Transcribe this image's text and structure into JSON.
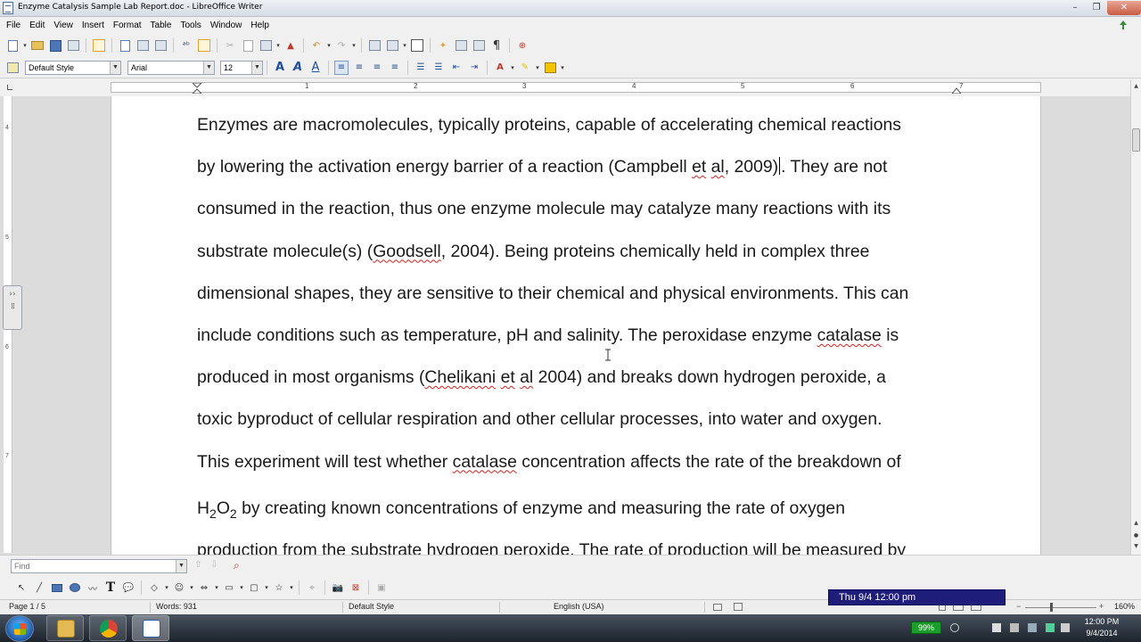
{
  "window": {
    "title": "Enzyme Catalysis Sample Lab Report.doc - LibreOffice Writer",
    "controls": [
      "–",
      "❐",
      "✕"
    ]
  },
  "menu": [
    "File",
    "Edit",
    "View",
    "Insert",
    "Format",
    "Table",
    "Tools",
    "Window",
    "Help"
  ],
  "format_bar": {
    "style": "Default Style",
    "font": "Arial",
    "size": "12"
  },
  "ruler_numbers": [
    "1",
    "2",
    "3",
    "4",
    "5",
    "6",
    "7"
  ],
  "document": {
    "lines": [
      [
        "Enzymes are macromolecules, typically proteins, capable of accelerating chemical reactions"
      ],
      [
        "by lowering the activation energy barrier of a reaction (Campbell ",
        "et",
        " ",
        "al",
        ", 2009)",
        ". They are not"
      ],
      [
        "consumed in the reaction, thus one enzyme molecule may catalyze many reactions with its"
      ],
      [
        "substrate molecule(s) (",
        "Goodsell",
        ", 2004). Being proteins chemically held in complex three"
      ],
      [
        "dimensional shapes, they are sensitive to their chemical and physical environments. This can"
      ],
      [
        "include conditions such as temperature, pH and salinity. The peroxidase enzyme ",
        "catalase",
        " is"
      ],
      [
        "produced in most organisms (",
        "Chelikani",
        " ",
        "et",
        " ",
        "al",
        " 2004) and breaks down hydrogen peroxide, a"
      ],
      [
        "toxic byproduct of cellular respiration and other cellular processes, into water and oxygen."
      ],
      [
        "This experiment will test whether ",
        "catalase",
        " concentration affects the rate of the breakdown of"
      ],
      [
        "H",
        "2",
        "O",
        "2",
        " by creating known concentrations of enzyme and measuring the rate of oxygen"
      ],
      [
        "production from the substrate hydrogen peroxide. The rate of production will be measured by"
      ]
    ]
  },
  "find": {
    "placeholder": "Find"
  },
  "status": {
    "page": "Page 1 / 5",
    "words": "Words: 931",
    "style": "Default Style",
    "language": "English (USA)",
    "zoom": "160%"
  },
  "overlay": {
    "datetime": "Thu 9/4   12:00 pm"
  },
  "taskbar": {
    "battery": "99%",
    "time": "12:00 PM",
    "date": "9/4/2014"
  },
  "colors": {
    "spell_underline": "#d42020",
    "overlay_bg": "#1f1d7a",
    "battery": "#1b9e29"
  }
}
